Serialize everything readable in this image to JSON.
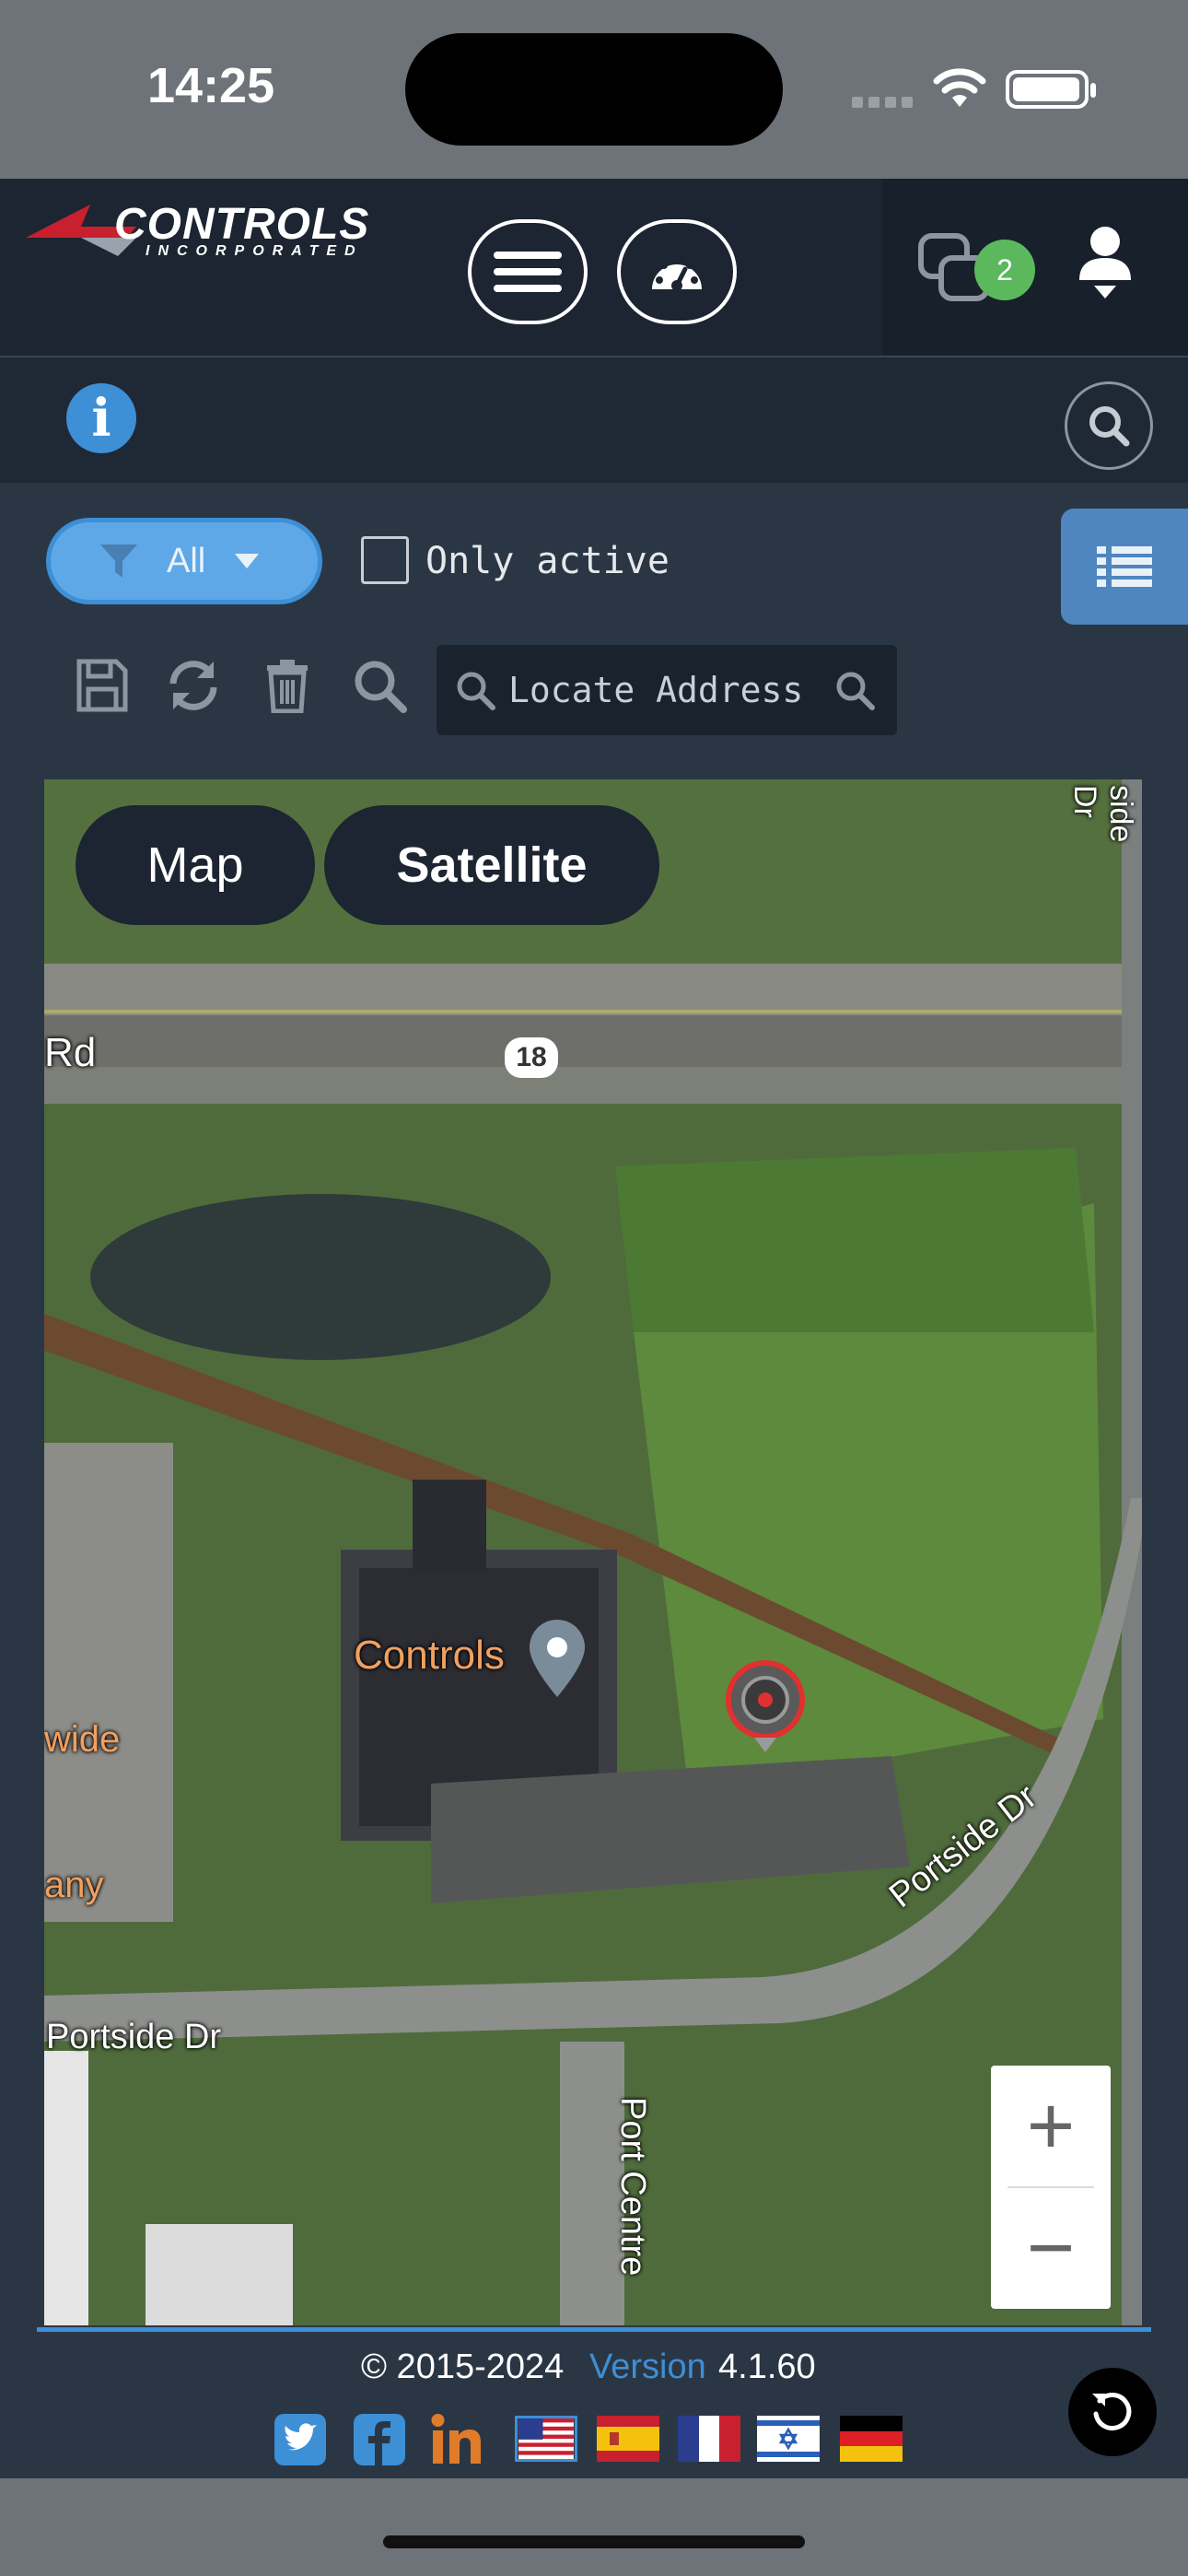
{
  "status_bar": {
    "time": "14:25"
  },
  "header": {
    "logo_text": "CONTROLS",
    "logo_sub": "INCORPORATED",
    "notification_count": "2"
  },
  "toolbar": {
    "filter_label": "All",
    "only_active_label": "Only active",
    "only_active_checked": false,
    "locate_placeholder": "Locate Address ..."
  },
  "map": {
    "toggle_map": "Map",
    "toggle_satellite": "Satellite",
    "selected_view": "Satellite",
    "labels": {
      "rd": "Rd",
      "route": "18",
      "controls": "Controls",
      "wide": "wide",
      "any": "any",
      "portside_dr": "Portside Dr",
      "portside_dr_curved": "Portside Dr",
      "port_centre": "Port Centre",
      "side_dr": "side Dr"
    },
    "zoom_in": "+",
    "zoom_out": "−"
  },
  "footer": {
    "copyright": "© 2015-2024",
    "version_label": "Version",
    "version_number": "4.1.60"
  },
  "colors": {
    "accent": "#3d8fd6",
    "header_bg": "#1c2531",
    "page_bg": "#2b3645",
    "badge": "#5cb85c"
  }
}
